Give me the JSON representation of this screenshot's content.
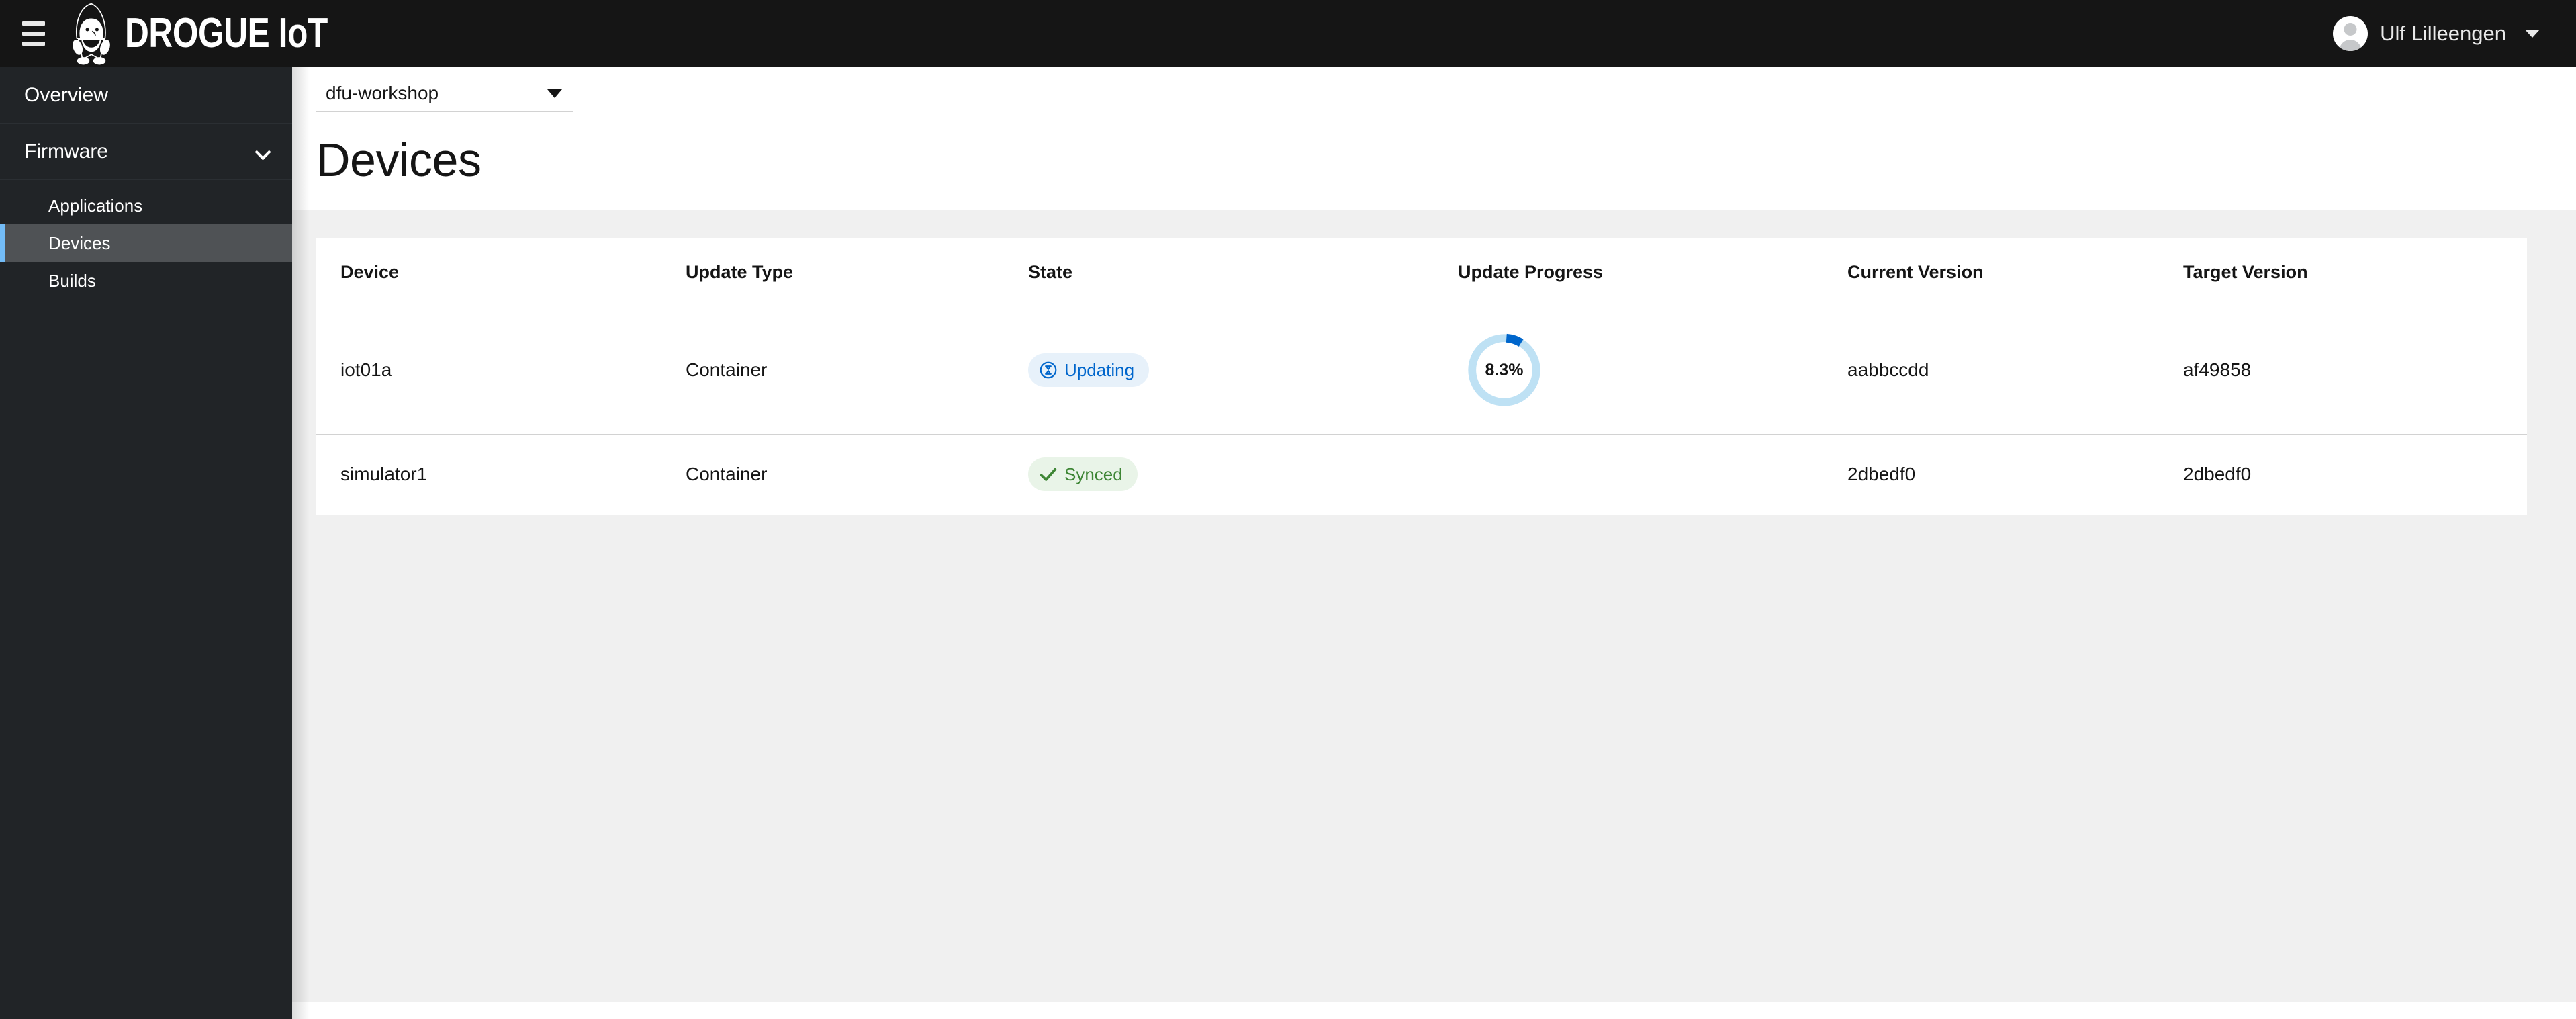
{
  "masthead": {
    "menu_icon": "hamburger-icon",
    "brand_text": "DROGUE IoT",
    "brand_logo_icon": "gnome-logo-icon",
    "user": {
      "name": "Ulf Lilleengen",
      "avatar_icon": "user-avatar-icon",
      "caret_icon": "caret-down-icon"
    }
  },
  "sidebar": {
    "items": [
      {
        "label": "Overview",
        "selected": false,
        "expandable": false
      },
      {
        "label": "Firmware",
        "selected": false,
        "expandable": true,
        "chevron_icon": "chevron-down-icon"
      },
      {
        "label": "Applications",
        "selected": false,
        "sub": true
      },
      {
        "label": "Devices",
        "selected": true,
        "sub": true
      },
      {
        "label": "Builds",
        "selected": false,
        "sub": true
      }
    ]
  },
  "toolbar": {
    "app_select": {
      "value": "dfu-workshop",
      "caret_icon": "caret-down-icon"
    }
  },
  "page": {
    "title": "Devices"
  },
  "table": {
    "columns": [
      "Device",
      "Update Type",
      "State",
      "Update Progress",
      "Current Version",
      "Target Version"
    ],
    "rows": [
      {
        "device": "iot01a",
        "update_type": "Container",
        "state": {
          "label": "Updating",
          "variant": "updating",
          "icon": "hourglass-icon"
        },
        "progress": {
          "label": "8.3%",
          "value": 8.3
        },
        "current_version": "aabbccdd",
        "target_version": "af49858"
      },
      {
        "device": "simulator1",
        "update_type": "Container",
        "state": {
          "label": "Synced",
          "variant": "synced",
          "icon": "check-icon"
        },
        "progress": null,
        "current_version": "2dbedf0",
        "target_version": "2dbedf0"
      }
    ]
  },
  "colors": {
    "masthead_bg": "#151515",
    "sidebar_bg": "#212427",
    "sidebar_selected_bg": "#4f5255",
    "sidebar_accent": "#73bcf7",
    "content_bg": "#f0f0f0",
    "card_bg": "#ffffff",
    "progress_arc": "#0066cc",
    "progress_track": "#bee1f4",
    "badge_updating_bg": "#e7f1fa",
    "badge_updating_fg": "#0066cc",
    "badge_synced_bg": "#e9f4e8",
    "badge_synced_fg": "#3e8635"
  }
}
